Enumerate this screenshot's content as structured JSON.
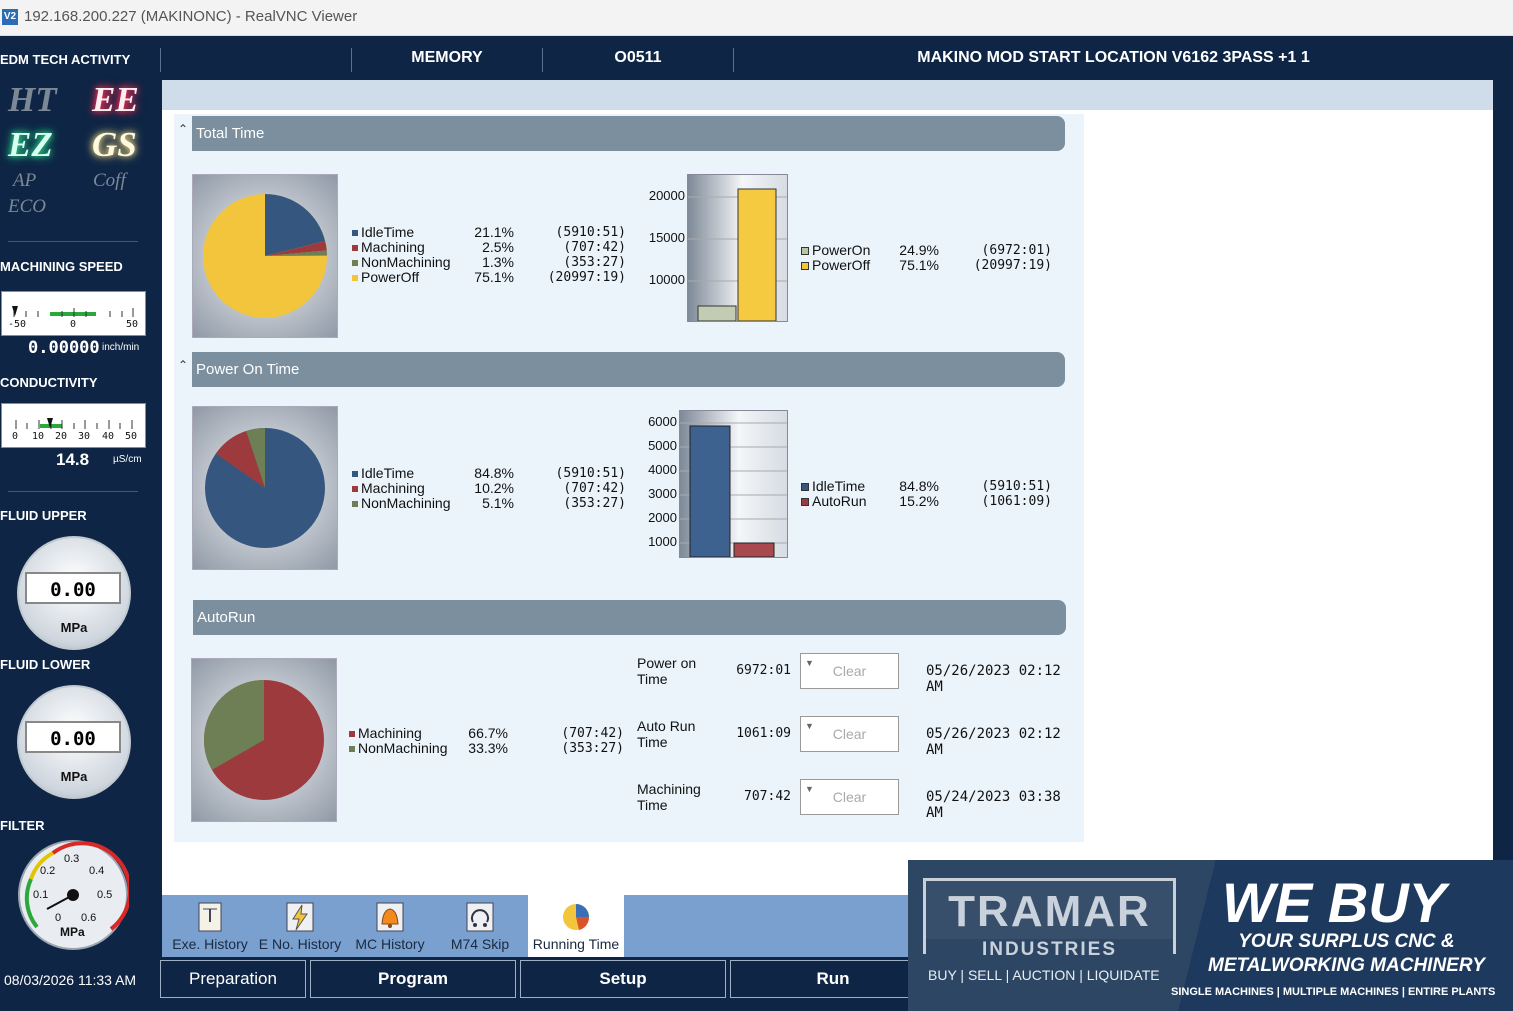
{
  "window": {
    "title": "192.168.200.227 (MAKINONC) - RealVNC Viewer",
    "logo": "V2"
  },
  "sidebar": {
    "edm_title": "EDM TECH ACTIVITY",
    "modes": [
      "HT",
      "EE",
      "EZ",
      "GS",
      "AP",
      "Coff",
      "ECO"
    ],
    "machining_speed": {
      "title": "MACHINING SPEED",
      "ticks": [
        "-50",
        "0",
        "50"
      ],
      "value": "0.00000",
      "unit": "inch/min"
    },
    "conductivity": {
      "title": "CONDUCTIVITY",
      "ticks": [
        "0",
        "10",
        "20",
        "30",
        "40",
        "50"
      ],
      "value": "14.8",
      "unit": "µS/cm"
    },
    "fluid_upper": {
      "title": "FLUID UPPER",
      "value": "0.00",
      "unit": "MPa"
    },
    "fluid_lower": {
      "title": "FLUID LOWER",
      "value": "0.00",
      "unit": "MPa"
    },
    "filter": {
      "title": "FILTER",
      "ticks": [
        "0.1",
        "0.2",
        "0.3",
        "0.4",
        "0.5",
        "0.6",
        "0"
      ],
      "unit": "MPa"
    },
    "datetime": "08/03/2026 11:33 AM"
  },
  "header": {
    "mode": "MEMORY",
    "program": "O0511",
    "program_name": "MAKINO MOD START LOCATION V6162 3PASS +1 1"
  },
  "colors": {
    "idle": "#35577f",
    "machining": "#9c3a3e",
    "nonmachining": "#6f7f55",
    "poweroff": "#f2c53c",
    "poweron": "#b8c4a4"
  },
  "total_time": {
    "title": "Total Time",
    "legend": [
      {
        "label": "IdleTime",
        "pct": "21.1%",
        "time": "(5910:51)",
        "color": "#35577f"
      },
      {
        "label": "Machining",
        "pct": "2.5%",
        "time": "(707:42)",
        "color": "#9c3a3e"
      },
      {
        "label": "NonMachining",
        "pct": "1.3%",
        "time": "(353:27)",
        "color": "#6f7f55"
      },
      {
        "label": "PowerOff",
        "pct": "75.1%",
        "time": "(20997:19)",
        "color": "#f2c53c"
      }
    ],
    "bar_ticks": [
      "20000",
      "15000",
      "10000"
    ],
    "bar_legend": [
      {
        "label": "PowerOn",
        "pct": "24.9%",
        "time": "(6972:01)",
        "color": "#b8c4a4"
      },
      {
        "label": "PowerOff",
        "pct": "75.1%",
        "time": "(20997:19)",
        "color": "#f2c53c"
      }
    ]
  },
  "power_on_time": {
    "title": "Power On Time",
    "legend": [
      {
        "label": "IdleTime",
        "pct": "84.8%",
        "time": "(5910:51)",
        "color": "#35577f"
      },
      {
        "label": "Machining",
        "pct": "10.2%",
        "time": "(707:42)",
        "color": "#9c3a3e"
      },
      {
        "label": "NonMachining",
        "pct": "5.1%",
        "time": "(353:27)",
        "color": "#6f7f55"
      }
    ],
    "bar_ticks": [
      "6000",
      "5000",
      "4000",
      "3000",
      "2000",
      "1000"
    ],
    "bar_legend": [
      {
        "label": "IdleTime",
        "pct": "84.8%",
        "time": "(5910:51)",
        "color": "#35577f"
      },
      {
        "label": "AutoRun",
        "pct": "15.2%",
        "time": "(1061:09)",
        "color": "#9c3a3e"
      }
    ]
  },
  "autorun": {
    "title": "AutoRun",
    "legend": [
      {
        "label": "Machining",
        "pct": "66.7%",
        "time": "(707:42)",
        "color": "#9c3a3e"
      },
      {
        "label": "NonMachining",
        "pct": "33.3%",
        "time": "(353:27)",
        "color": "#6f7f55"
      }
    ],
    "rows": [
      {
        "label1": "Power on",
        "label2": "Time",
        "value": "6972:01",
        "clear": "Clear",
        "date": "05/26/2023 02:12 AM"
      },
      {
        "label1": "Auto Run",
        "label2": "Time",
        "value": "1061:09",
        "clear": "Clear",
        "date": "05/26/2023 02:12 AM"
      },
      {
        "label1": "Machining",
        "label2": "Time",
        "value": "707:42",
        "clear": "Clear",
        "date": "05/24/2023 03:38 AM"
      }
    ]
  },
  "tabs": [
    "Exe. History",
    "E No. History",
    "MC History",
    "M74 Skip",
    "Running Time"
  ],
  "nav": [
    "Preparation",
    "Program",
    "Setup",
    "Run"
  ],
  "ad": {
    "brand": "TRAMAR",
    "brand_sub": "INDUSTRIES",
    "buy_line": "BUY | SELL | AUCTION | LIQUIDATE",
    "headline": "WE BUY",
    "sub1": "YOUR SURPLUS CNC &",
    "sub2": "METALWORKING MACHINERY",
    "small": "SINGLE MACHINES | MULTIPLE MACHINES | ENTIRE PLANTS"
  }
}
